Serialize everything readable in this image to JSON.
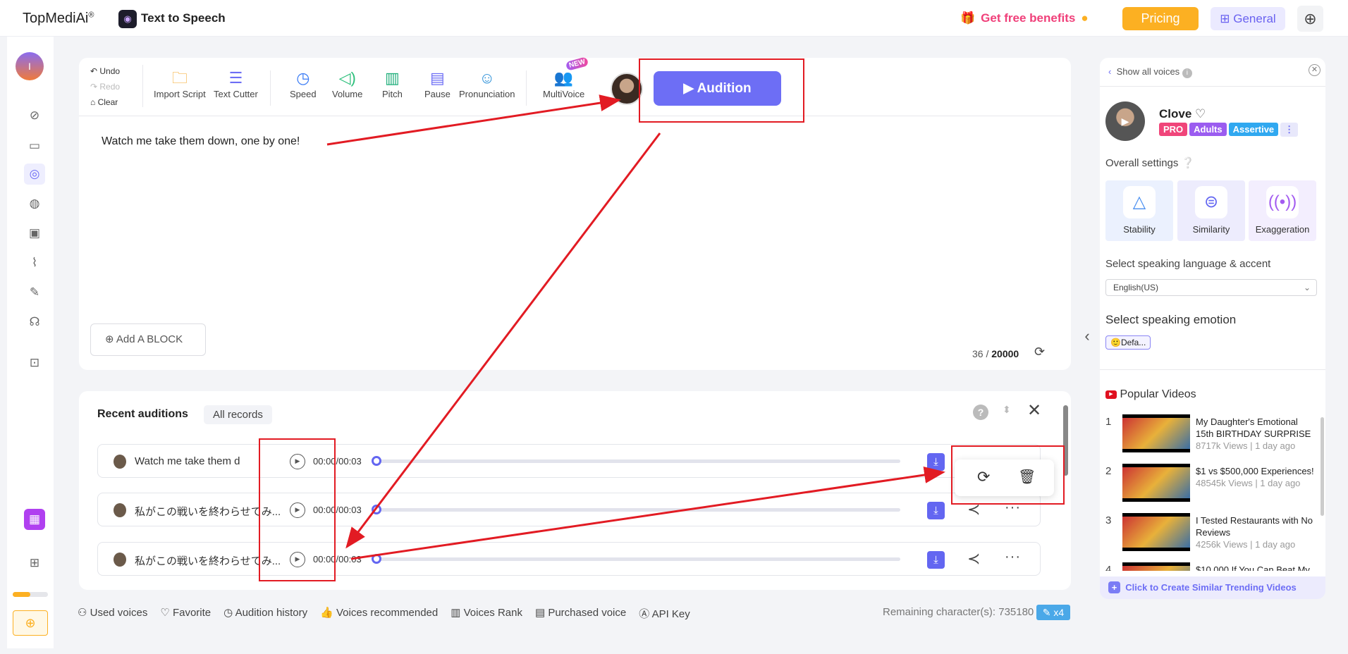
{
  "header": {
    "logo": "TopMediAi",
    "logo_mark": "®",
    "app_title": "Text to Speech",
    "benefits": "Get free benefits",
    "pricing": "Pricing",
    "general": "General"
  },
  "toolbar": {
    "undo": "Undo",
    "redo": "Redo",
    "clear": "Clear",
    "import_script": "Import Script",
    "text_cutter": "Text Cutter",
    "speed": "Speed",
    "volume": "Volume",
    "pitch": "Pitch",
    "pause": "Pause",
    "pronunciation": "Pronunciation",
    "multivoice": "MultiVoice",
    "new_badge": "NEW",
    "audition": "Audition"
  },
  "editor": {
    "text": "Watch me take them down, one by one!",
    "add_block": "Add A BLOCK",
    "char_count": "36",
    "char_limit": "20000"
  },
  "recent": {
    "title": "Recent auditions",
    "all_records": "All records",
    "rows": [
      {
        "title": "Watch me take them d",
        "time": "00:00/00:03"
      },
      {
        "title": "私がこの戦いを終わらせてみ...",
        "time": "00:00/00:03"
      },
      {
        "title": "私がこの戦いを終わらせてみ...",
        "time": "00:00/00:03"
      }
    ]
  },
  "bottom": {
    "links": [
      "Used voices",
      "Favorite",
      "Audition history",
      "Voices recommended",
      "Voices Rank",
      "Purchased voice",
      "API Key"
    ],
    "remaining": "Remaining character(s): 735180",
    "multiplier": "x4"
  },
  "voice": {
    "show_all": "Show all voices",
    "name": "Clove",
    "tags": [
      "PRO",
      "Adults",
      "Assertive"
    ],
    "overall_settings": "Overall settings",
    "settings": [
      "Stability",
      "Similarity",
      "Exaggeration"
    ],
    "language_label": "Select speaking language & accent",
    "language": "English(US)",
    "emotion_label": "Select speaking emotion",
    "emotion": "Defa..."
  },
  "videos": {
    "title": "Popular Videos",
    "items": [
      {
        "n": "1",
        "title": "My Daughter's Emotional 15th BIRTHDAY SURPRISE",
        "meta": "8717k Views | 1 day ago"
      },
      {
        "n": "2",
        "title": "$1 vs $500,000 Experiences!",
        "meta": "48545k Views | 1 day ago"
      },
      {
        "n": "3",
        "title": "I Tested Restaurants with No Reviews",
        "meta": "4256k Views | 1 day ago"
      },
      {
        "n": "4",
        "title": "$10,000 If You Can Beat My",
        "meta": ""
      }
    ],
    "create": "Click to Create Similar Trending Videos"
  },
  "colors": {
    "accent": "#6d6ef5",
    "pricing": "#fcb022",
    "annotation": "#e21b23"
  }
}
